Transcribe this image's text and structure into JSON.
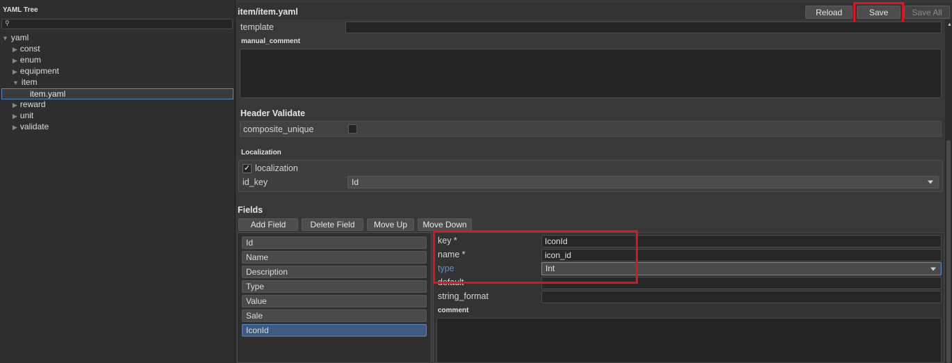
{
  "left_panel": {
    "title": "YAML Tree",
    "search_placeholder": "",
    "tree": {
      "root": "yaml",
      "const": "const",
      "enum": "enum",
      "equipment": "equipment",
      "item": "item",
      "item_yaml": "item.yaml",
      "reward": "reward",
      "unit": "unit",
      "validate": "validate"
    }
  },
  "header": {
    "path": "item/item.yaml",
    "reload": "Reload",
    "save": "Save",
    "save_all": "Save All"
  },
  "form": {
    "template_label": "template",
    "template_value": "",
    "manual_comment_label": "manual_comment",
    "header_validate_title": "Header Validate",
    "composite_unique_label": "composite_unique",
    "localization_title": "Localization",
    "localization_label": "localization",
    "localization_checked": true,
    "id_key_label": "id_key",
    "id_key_value": "Id"
  },
  "fields": {
    "title": "Fields",
    "add_field": "Add Field",
    "delete_field": "Delete Field",
    "move_up": "Move Up",
    "move_down": "Move Down",
    "list": [
      "Id",
      "Name",
      "Description",
      "Type",
      "Value",
      "Sale",
      "IconId"
    ],
    "selected_index": 6,
    "detail": {
      "key_label": "key *",
      "key_value": "IconId",
      "name_label": "name *",
      "name_value": "icon_id",
      "type_label": "type",
      "type_value": "Int",
      "default_label": "default",
      "default_value": "",
      "string_format_label": "string_format",
      "string_format_value": "",
      "comment_label": "comment"
    }
  },
  "colors": {
    "accent_blue": "#5b8fd6",
    "highlight_red": "#e0141e",
    "selected_item": "#3d5a80"
  }
}
